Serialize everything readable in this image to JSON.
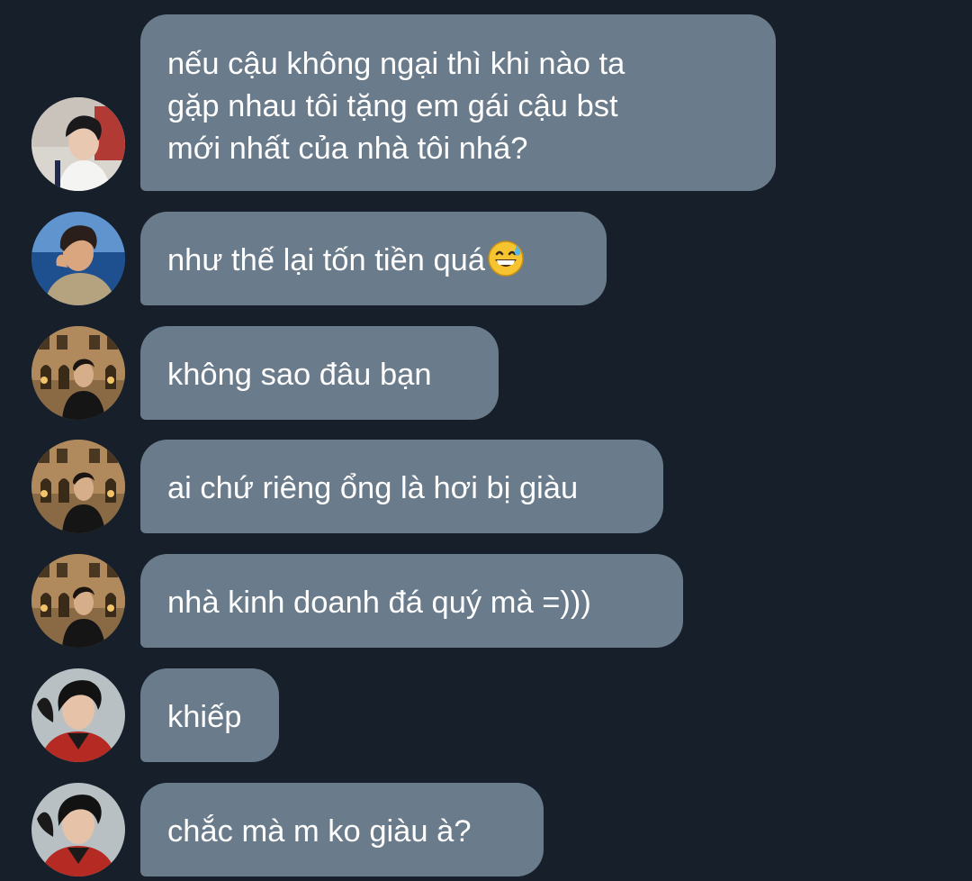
{
  "messages": [
    {
      "avatar": "avatar-young-man-white-shirt",
      "text": "nếu cậu không ngại thì khi nào ta gặp nhau tôi tặng em gái cậu bst mới nhất của nhà tôi nhá?",
      "lines": [
        "nếu cậu không ngại thì khi nào ta",
        "gặp nhau tôi tặng em gái cậu bst",
        "mới nhất của nhà tôi nhá?"
      ]
    },
    {
      "avatar": "avatar-man-by-sea",
      "text": "như thế lại tốn tiền quá",
      "emoji": "grinning-sweat-emoji"
    },
    {
      "avatar": "avatar-man-in-front-of-building",
      "text": "không sao đâu bạn"
    },
    {
      "avatar": "avatar-man-in-front-of-building",
      "text": "ai chứ riêng ổng là hơi bị giàu"
    },
    {
      "avatar": "avatar-man-in-front-of-building",
      "text": "nhà kinh doanh đá quý mà =)))"
    },
    {
      "avatar": "avatar-man-red-jacket",
      "text": "khiếp"
    },
    {
      "avatar": "avatar-man-red-jacket",
      "text": "chắc mà m ko giàu à?"
    }
  ],
  "colors": {
    "background": "#17202a",
    "bubble": "#6a7b8b",
    "text": "#ffffff"
  }
}
